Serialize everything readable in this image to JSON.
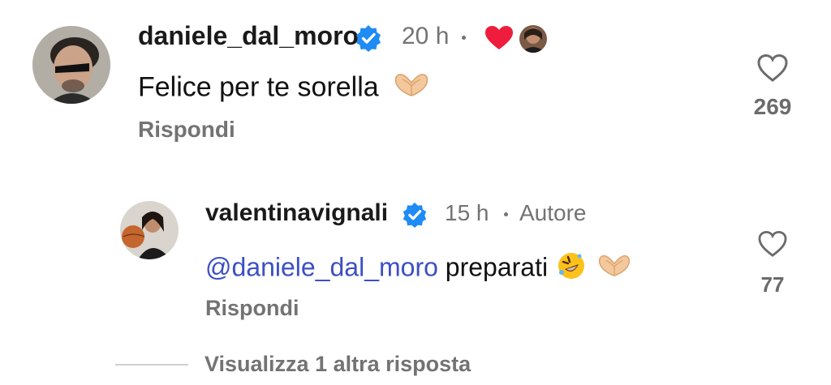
{
  "comments": [
    {
      "username": "daniele_dal_moro",
      "time": "20 h",
      "text": "Felice per te sorella",
      "reply_label": "Rispondi",
      "likes": "269",
      "liked_by_author": true,
      "icons": [
        "verified-badge-icon",
        "red-heart-icon",
        "heart-hands-emoji"
      ]
    },
    {
      "username": "valentinavignali",
      "time": "15 h",
      "author_label": "Autore",
      "mention": "@daniele_dal_moro",
      "text": "preparati",
      "reply_label": "Rispondi",
      "likes": "77",
      "icons": [
        "verified-badge-icon",
        "rolling-laughing-emoji",
        "heart-hands-emoji"
      ]
    }
  ],
  "view_more_label": "Visualizza 1 altra risposta",
  "colors": {
    "verified": "#1f8bf5",
    "like_heart": "#ee1d3d",
    "mention": "#3c4fc4",
    "secondary_text": "#737373"
  }
}
